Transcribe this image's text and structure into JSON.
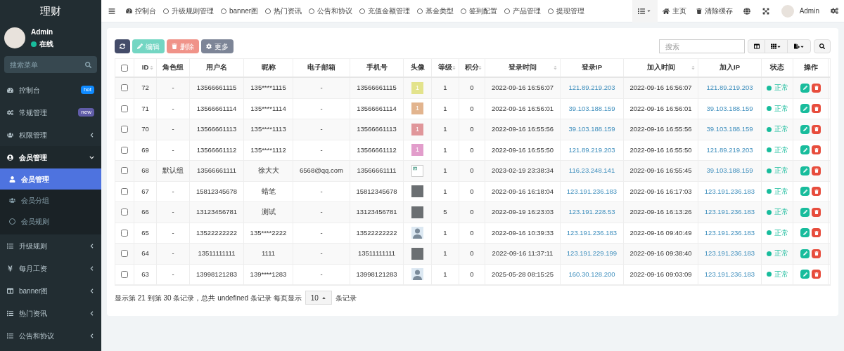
{
  "sidebar": {
    "title": "理财",
    "user": {
      "name": "Admin",
      "status": "在线"
    },
    "search": {
      "placeholder": "搜索菜单"
    },
    "items": [
      {
        "label": "控制台",
        "kind": "link",
        "selected": false,
        "badge": {
          "text": "hot",
          "color": "#0f8aff"
        }
      },
      {
        "label": "常规管理",
        "kind": "link",
        "selected": false,
        "badge": {
          "text": "new",
          "color": "#605ca8"
        }
      },
      {
        "label": "权限管理",
        "kind": "group",
        "selected": false,
        "expanded": false
      },
      {
        "label": "会员管理",
        "kind": "group",
        "selected": false,
        "expanded": true,
        "children": [
          {
            "label": "会员管理",
            "selected": true
          },
          {
            "label": "会员分组",
            "selected": false
          },
          {
            "label": "会员规则",
            "selected": false
          }
        ]
      },
      {
        "label": "升级规则",
        "kind": "group",
        "selected": false,
        "expanded": false
      },
      {
        "label": "每月工资",
        "kind": "group",
        "selected": false,
        "expanded": false
      },
      {
        "label": "banner图",
        "kind": "group",
        "selected": false,
        "expanded": false
      },
      {
        "label": "热门资讯",
        "kind": "group",
        "selected": false,
        "expanded": false
      },
      {
        "label": "公告和协议",
        "kind": "group",
        "selected": false,
        "expanded": false
      }
    ]
  },
  "top_nav": {
    "tabs": [
      {
        "label": "控制台"
      },
      {
        "label": "升级规则管理"
      },
      {
        "label": "banner图"
      },
      {
        "label": "热门资讯"
      },
      {
        "label": "公告和协议"
      },
      {
        "label": "充值金额管理"
      },
      {
        "label": "基金类型"
      },
      {
        "label": "签到配置"
      },
      {
        "label": "产品管理"
      },
      {
        "label": "提现管理"
      }
    ],
    "home": "主页",
    "clear_cache": "清除缓存",
    "user": "Admin"
  },
  "toolbar": {
    "buttons": [
      {
        "kind": "refresh",
        "disabled": false
      },
      {
        "kind": "edit",
        "label": "编辑",
        "disabled": true
      },
      {
        "kind": "delete",
        "label": "删除",
        "disabled": true
      },
      {
        "kind": "more",
        "label": "更多",
        "disabled": false
      }
    ],
    "search": {
      "placeholder": "搜索"
    }
  },
  "table": {
    "select_all_checked": false,
    "columns": [
      {
        "label": "ID",
        "sortable": true
      },
      {
        "label": "角色组",
        "sortable": false
      },
      {
        "label": "用户名",
        "sortable": false
      },
      {
        "label": "昵称",
        "sortable": false
      },
      {
        "label": "电子邮箱",
        "sortable": false
      },
      {
        "label": "手机号",
        "sortable": false
      },
      {
        "label": "头像",
        "sortable": false
      },
      {
        "label": "等级",
        "sortable": true
      },
      {
        "label": "积分",
        "sortable": true
      },
      {
        "label": "登录时间",
        "sortable": true
      },
      {
        "label": "登录IP",
        "sortable": false
      },
      {
        "label": "加入时间",
        "sortable": true
      },
      {
        "label": "加入IP",
        "sortable": false
      },
      {
        "label": "状态",
        "sortable": false
      },
      {
        "label": "操作",
        "sortable": false
      }
    ],
    "rows": [
      {
        "checked": false,
        "id": "72",
        "group": "-",
        "username": "13566661115",
        "nickname": "135****1115",
        "email": "-",
        "phone": "13566661115",
        "avatar": {
          "kind": "letter",
          "text": "1",
          "color": "#e3e38c"
        },
        "level": "1",
        "score": "0",
        "login_time": "2022-09-16 16:56:07",
        "login_ip": "121.89.219.203",
        "join_time": "2022-09-16 16:56:07",
        "join_ip": "121.89.219.203",
        "status": "正常"
      },
      {
        "checked": false,
        "id": "71",
        "group": "-",
        "username": "13566661114",
        "nickname": "135****1114",
        "email": "-",
        "phone": "13566661114",
        "avatar": {
          "kind": "letter",
          "text": "1",
          "color": "#e2b48e"
        },
        "level": "1",
        "score": "0",
        "login_time": "2022-09-16 16:56:01",
        "login_ip": "39.103.188.159",
        "join_time": "2022-09-16 16:56:01",
        "join_ip": "39.103.188.159",
        "status": "正常"
      },
      {
        "checked": false,
        "id": "70",
        "group": "-",
        "username": "13566661113",
        "nickname": "135****1113",
        "email": "-",
        "phone": "13566661113",
        "avatar": {
          "kind": "letter",
          "text": "1",
          "color": "#e0969a"
        },
        "level": "1",
        "score": "0",
        "login_time": "2022-09-16 16:55:56",
        "login_ip": "39.103.188.159",
        "join_time": "2022-09-16 16:55:56",
        "join_ip": "39.103.188.159",
        "status": "正常"
      },
      {
        "checked": false,
        "id": "69",
        "group": "-",
        "username": "13566661112",
        "nickname": "135****1112",
        "email": "-",
        "phone": "13566661112",
        "avatar": {
          "kind": "letter",
          "text": "1",
          "color": "#e29dcb"
        },
        "level": "1",
        "score": "0",
        "login_time": "2022-09-16 16:55:50",
        "login_ip": "121.89.219.203",
        "join_time": "2022-09-16 16:55:50",
        "join_ip": "121.89.219.203",
        "status": "正常"
      },
      {
        "checked": false,
        "id": "68",
        "group": "默认组",
        "username": "13566661111",
        "nickname": "徐大大",
        "email": "6568@qq.com",
        "phone": "13566661111",
        "avatar": {
          "kind": "broken"
        },
        "level": "1",
        "score": "0",
        "login_time": "2023-02-19 23:38:34",
        "login_ip": "116.23.248.141",
        "join_time": "2022-09-16 16:55:45",
        "join_ip": "39.103.188.159",
        "status": "正常"
      },
      {
        "checked": false,
        "id": "67",
        "group": "-",
        "username": "15812345678",
        "nickname": "蜡笔",
        "email": "-",
        "phone": "15812345678",
        "avatar": {
          "kind": "photo"
        },
        "level": "1",
        "score": "0",
        "login_time": "2022-09-16 16:18:04",
        "login_ip": "123.191.236.183",
        "join_time": "2022-09-16 16:17:03",
        "join_ip": "123.191.236.183",
        "status": "正常"
      },
      {
        "checked": false,
        "id": "66",
        "group": "-",
        "username": "13123456781",
        "nickname": "测试",
        "email": "-",
        "phone": "13123456781",
        "avatar": {
          "kind": "photo"
        },
        "level": "5",
        "score": "0",
        "login_time": "2022-09-19 16:23:03",
        "login_ip": "123.191.228.53",
        "join_time": "2022-09-16 16:13:26",
        "join_ip": "123.191.236.183",
        "status": "正常"
      },
      {
        "checked": false,
        "id": "65",
        "group": "-",
        "username": "13522222222",
        "nickname": "135****2222",
        "email": "-",
        "phone": "13522222222",
        "avatar": {
          "kind": "cartoon"
        },
        "level": "1",
        "score": "0",
        "login_time": "2022-09-16 10:39:33",
        "login_ip": "123.191.236.183",
        "join_time": "2022-09-16 09:40:49",
        "join_ip": "123.191.236.183",
        "status": "正常"
      },
      {
        "checked": false,
        "id": "64",
        "group": "-",
        "username": "13511111111",
        "nickname": "1111",
        "email": "-",
        "phone": "13511111111",
        "avatar": {
          "kind": "photo"
        },
        "level": "1",
        "score": "0",
        "login_time": "2022-09-16 11:37:11",
        "login_ip": "123.191.229.199",
        "join_time": "2022-09-16 09:38:40",
        "join_ip": "123.191.236.183",
        "status": "正常"
      },
      {
        "checked": false,
        "id": "63",
        "group": "-",
        "username": "13998121283",
        "nickname": "139****1283",
        "email": "-",
        "phone": "13998121283",
        "avatar": {
          "kind": "cartoon"
        },
        "level": "1",
        "score": "0",
        "login_time": "2025-05-28 08:15:25",
        "login_ip": "160.30.128.200",
        "join_time": "2022-09-16 09:03:09",
        "join_ip": "123.191.236.183",
        "status": "正常"
      }
    ]
  },
  "pagination": {
    "summary": "显示第 21 到第 30 条记录，总共 undefined 条记录 每页显示",
    "page_size": "10",
    "suffix": "条记录"
  }
}
